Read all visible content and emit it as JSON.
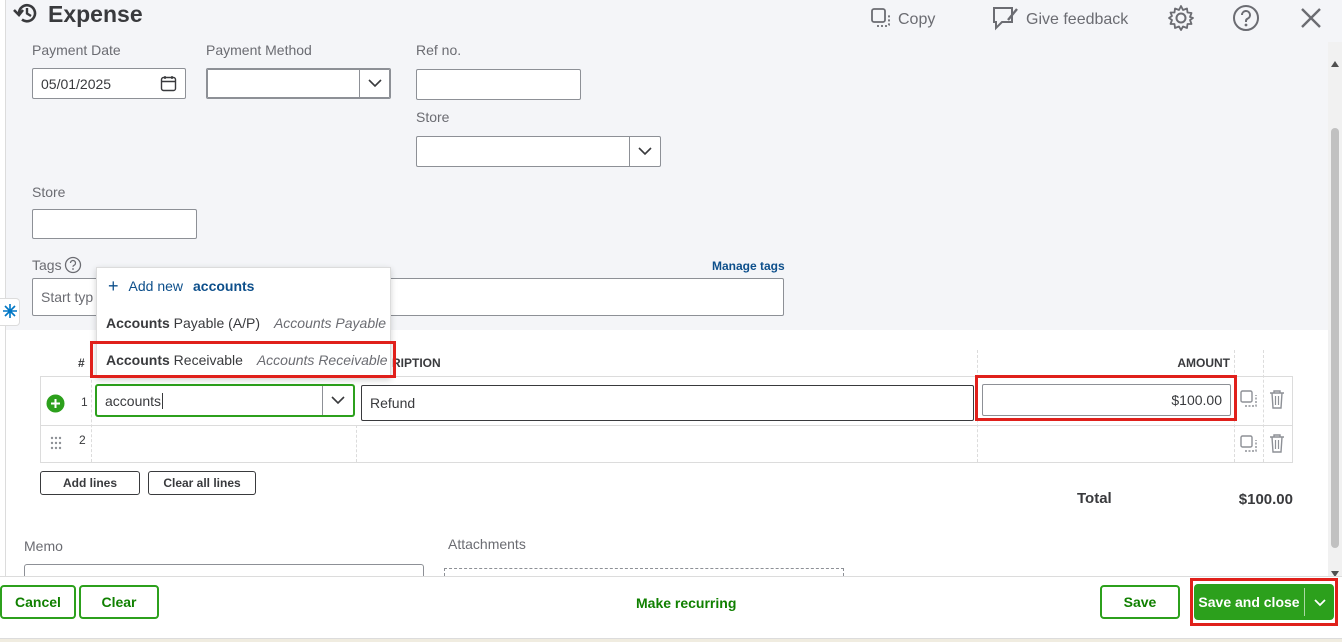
{
  "header": {
    "title": "Expense",
    "copy_label": "Copy",
    "feedback_label": "Give feedback"
  },
  "form": {
    "payment_date_label": "Payment Date",
    "payment_date_value": "05/01/2025",
    "payment_method_label": "Payment Method",
    "ref_no_label": "Ref no.",
    "store_label_right": "Store",
    "store_label_left": "Store",
    "tags_label": "Tags",
    "tags_placeholder": "Start typ",
    "manage_tags": "Manage tags"
  },
  "dropdown": {
    "add_new_prefix": "Add new",
    "add_new_term": "accounts",
    "items": [
      {
        "match": "Accounts",
        "rest": " Payable (A/P)",
        "type": "Accounts Payable"
      },
      {
        "match": "Accounts",
        "rest": " Receivable",
        "type": "Accounts Receivable"
      }
    ]
  },
  "table": {
    "col_num": "#",
    "col_desc_partial": "RIPTION",
    "col_amount": "AMOUNT",
    "rows": [
      {
        "num": "1",
        "account": "accounts",
        "description": "Refund",
        "amount": "$100.00"
      },
      {
        "num": "2",
        "account": "",
        "description": "",
        "amount": ""
      }
    ],
    "add_lines": "Add lines",
    "clear_all_lines": "Clear all lines",
    "total_label": "Total",
    "total_value": "$100.00"
  },
  "bottom": {
    "memo_label": "Memo",
    "attachments_label": "Attachments"
  },
  "footer": {
    "cancel": "Cancel",
    "clear": "Clear",
    "make_recurring": "Make recurring",
    "save": "Save",
    "save_and_close": "Save and close"
  },
  "colors": {
    "green": "#2ca01c",
    "dark_green": "#108000",
    "red_highlight": "#e0201b",
    "link_blue": "#0d4f8b"
  }
}
